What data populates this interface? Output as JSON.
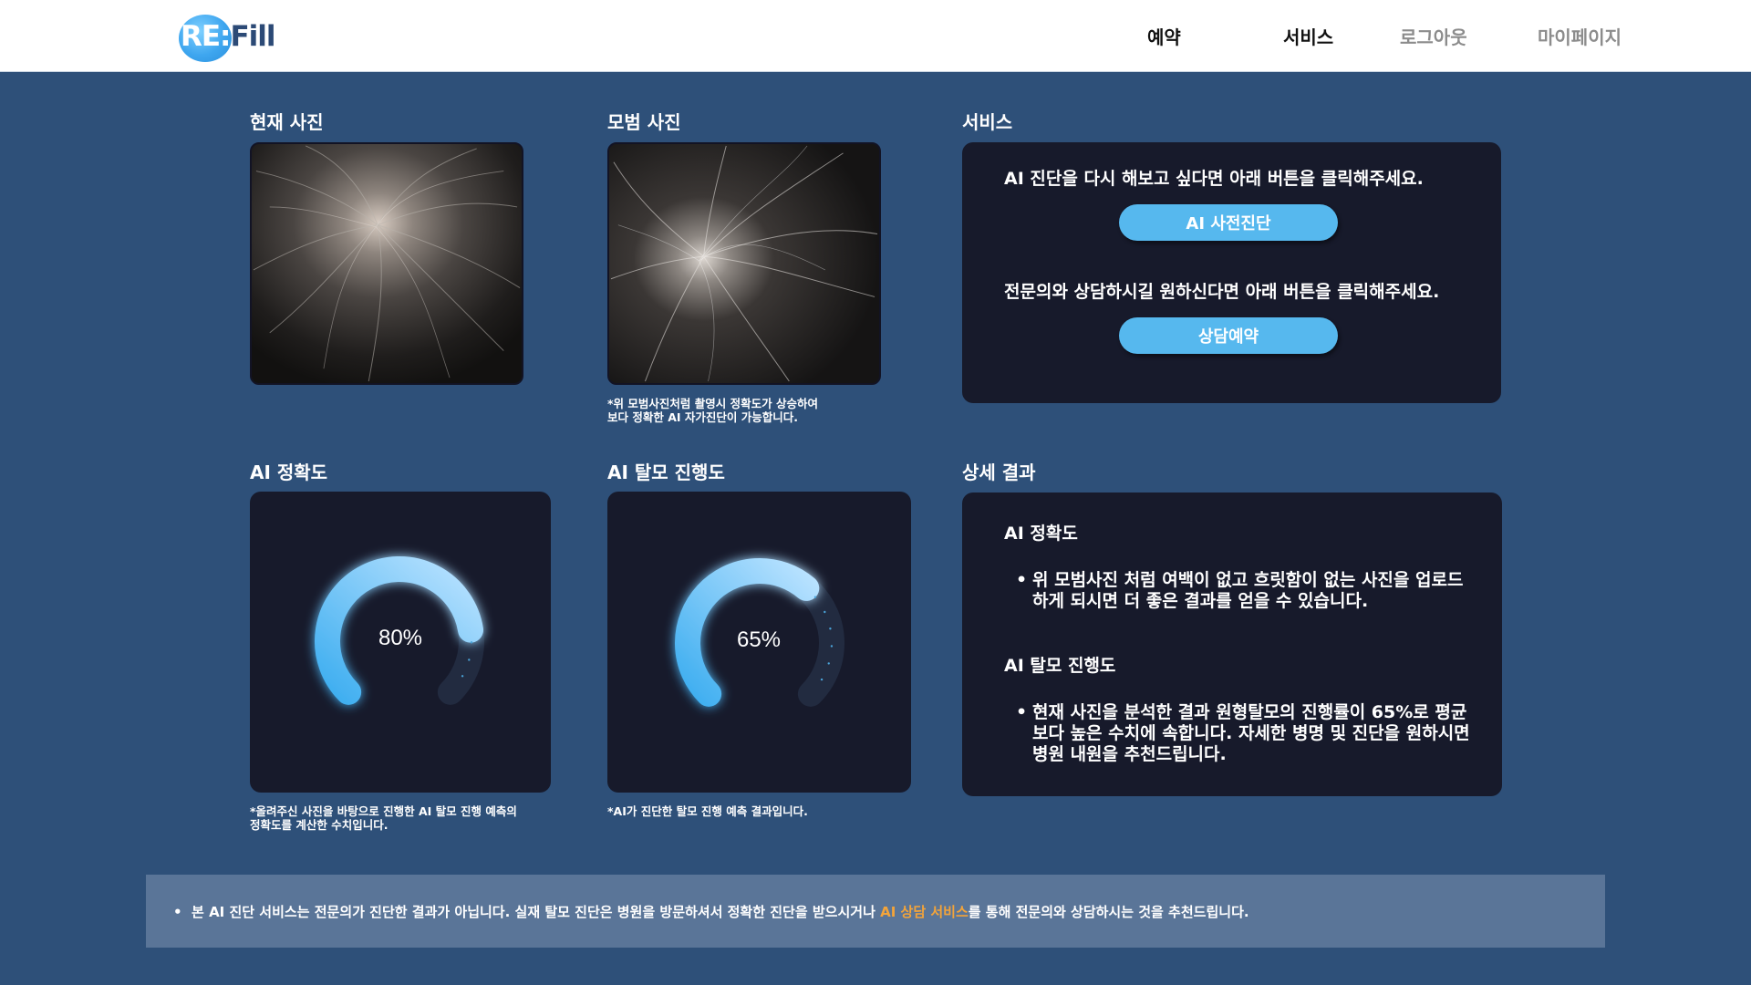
{
  "header": {
    "logo_text_re": "RE:",
    "logo_text_fill": "Fill",
    "nav": [
      "예약",
      "서비스",
      "로그아웃",
      "마이페이지"
    ]
  },
  "current_photo": {
    "title": "현재 사진"
  },
  "model_photo": {
    "title": "모범 사진",
    "note_line1": "*위 모범사진처럼 촬영시 정확도가 상승하여",
    "note_line2": "보다 정확한 AI 자가진단이 가능합니다."
  },
  "service": {
    "title": "서비스",
    "line1": "AI 진단을 다시 해보고 싶다면 아래 버튼을 클릭해주세요.",
    "button1": "AI 사전진단",
    "line2": "전문의와 상담하시길 원하신다면 아래 버튼을 클릭해주세요.",
    "button2": "상담예약"
  },
  "ai_accuracy": {
    "title": "AI 정확도",
    "value": 80,
    "value_label": "80%",
    "note_line1": "*올려주신 사진을 바탕으로 진행한 AI 탈모 진행 예측의",
    "note_line2": "정확도를 계산한 수치입니다."
  },
  "ai_progress": {
    "title": "AI 탈모 진행도",
    "value": 65,
    "value_label": "65%",
    "note": "*AI가 진단한 탈모 진행 예측 결과입니다."
  },
  "details": {
    "title": "상세 결과",
    "head1": "AI  정확도",
    "bullet1_line1": "위 모범사진 처럼 여백이 없고 흐릿함이 없는 사진을 업로드",
    "bullet1_line2": "하게 되시면 더 좋은 결과를 얻을 수 있습니다.",
    "head2": "AI  탈모 진행도",
    "bullet2_line1": "현재 사진을 분석한 결과 원형탈모의 진행률이 65%로 평균",
    "bullet2_line2": "보다 높은 수치에 속합니다. 자세한 병명 및 진단을 원하시면",
    "bullet2_line3": "병원 내원을 추천드립니다."
  },
  "footer": {
    "bullet": "•",
    "text_before": "본 AI 진단 서비스는 전문의가 진단한 결과가 아닙니다. 실재 탈모 진단은 병원을 방문하셔서 정확한 진단을 받으시거나 ",
    "text_highlight": "AI 상담 서비스",
    "text_after": "를 통해 전문의와 상담하시는 것을 추천드립니다."
  },
  "colors": {
    "background": "#2e5079",
    "card": "#171a2b",
    "accent": "#56b8ee",
    "highlight": "#f3a43a"
  }
}
